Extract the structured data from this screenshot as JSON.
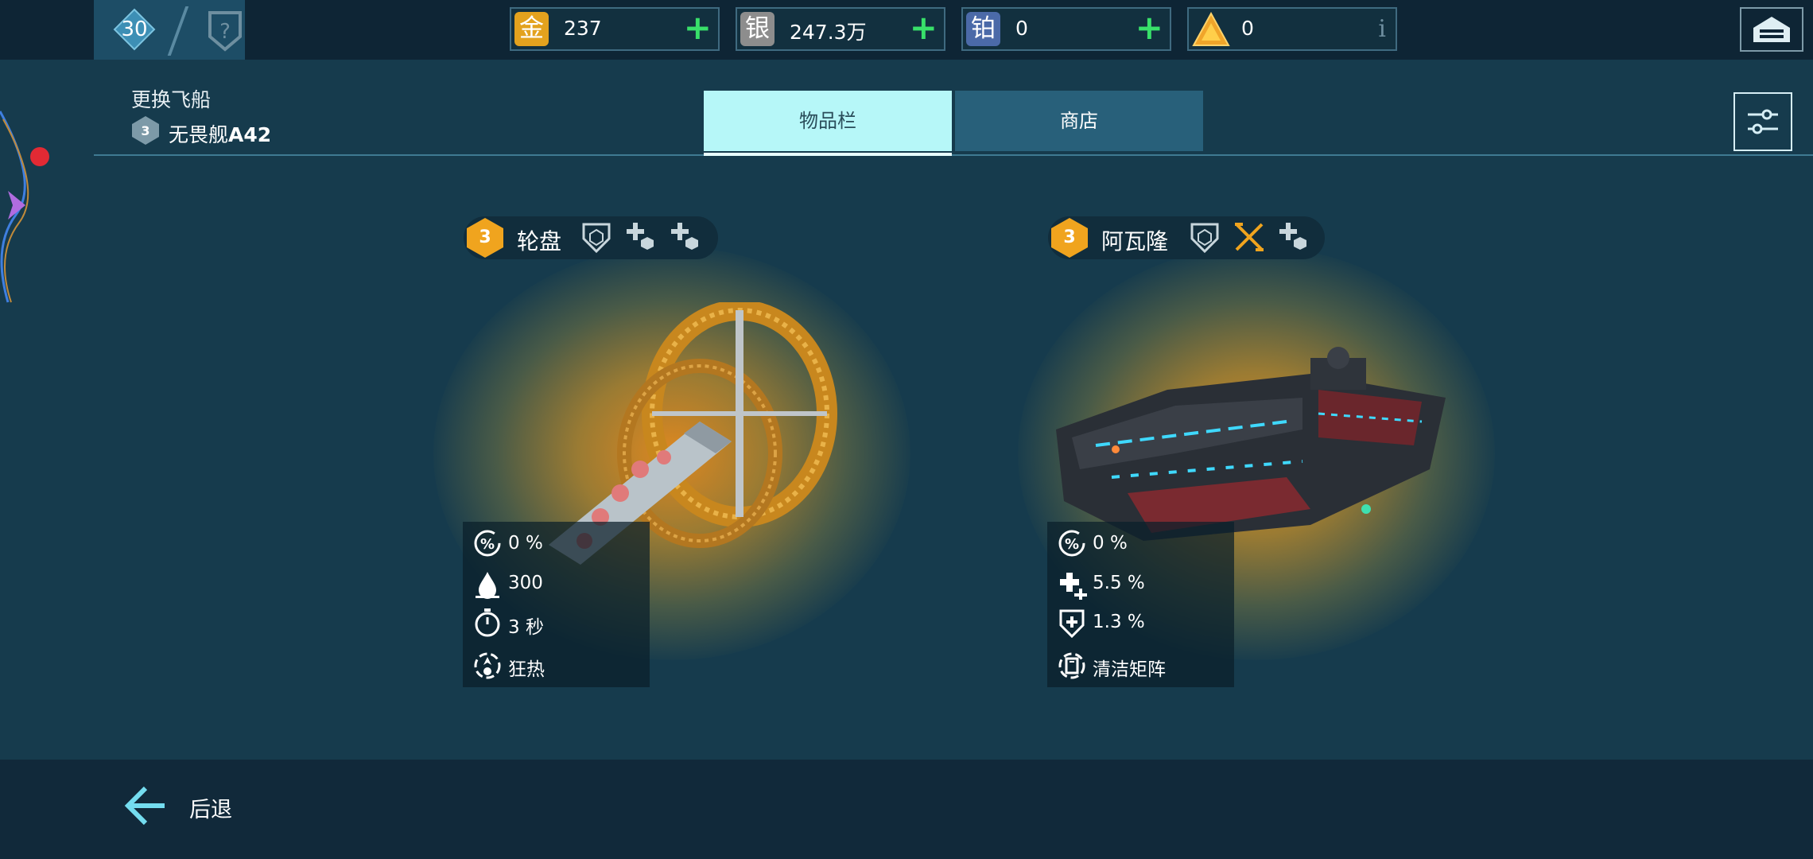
{
  "level": "30",
  "currencies": [
    {
      "icon_char": "金",
      "value": "237",
      "plus": "+",
      "color": "#e3a21e"
    },
    {
      "icon_char": "银",
      "value": "247.3万",
      "plus": "+",
      "color": "#8d8d8d"
    },
    {
      "icon_char": "铂",
      "value": "0",
      "plus": "+",
      "color": "#4b6aa8"
    },
    {
      "icon_char": "",
      "value": "0",
      "info": "i",
      "color": "#f0a52a"
    }
  ],
  "header": {
    "title": "更换飞船",
    "ship_tier": "3",
    "ship_name_prefix": "无畏舰",
    "ship_name_code": "A42"
  },
  "tabs": {
    "inventory": "物品栏",
    "shop": "商店"
  },
  "ships": [
    {
      "tier": "3",
      "name": "轮盘",
      "stats": [
        {
          "icon": "percent-icon",
          "text": "0 %"
        },
        {
          "icon": "drop-icon",
          "text": "300"
        },
        {
          "icon": "timer-icon",
          "text": "3 秒"
        },
        {
          "icon": "frenzy-icon",
          "text": "狂热"
        }
      ]
    },
    {
      "tier": "3",
      "name": "阿瓦隆",
      "stats": [
        {
          "icon": "percent-icon",
          "text": "0 %"
        },
        {
          "icon": "repair-plus-icon",
          "text": "5.5 %"
        },
        {
          "icon": "shield-plus-icon",
          "text": "1.3 %"
        },
        {
          "icon": "cleanse-matrix-icon",
          "text": "清洁矩阵"
        }
      ]
    }
  ],
  "footer": {
    "back_label": "后退"
  },
  "colors": {
    "accent_cyan": "#b6f7f8",
    "tier_orange": "#f0a41e",
    "plus_green": "#38e06a",
    "alert_red": "#e22a34"
  }
}
